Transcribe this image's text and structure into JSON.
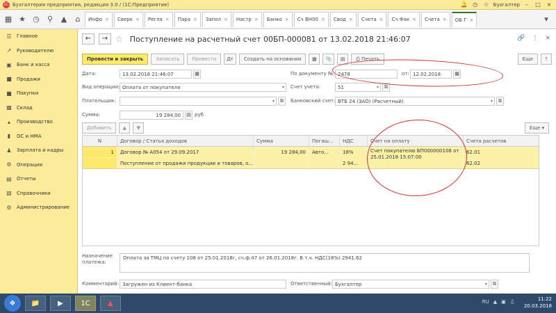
{
  "window": {
    "title": "Бухгалтерия предприятия, редакция 3.0 / (1С:Предприятие)",
    "user": "Бухгалтер"
  },
  "tabs": [
    {
      "label": "Инфо"
    },
    {
      "label": "Сверк"
    },
    {
      "label": "Регла"
    },
    {
      "label": "Пара"
    },
    {
      "label": "Запол"
    },
    {
      "label": "Настр"
    },
    {
      "label": "Банко"
    },
    {
      "label": "Сч ВН00"
    },
    {
      "label": "Свод"
    },
    {
      "label": "Счета"
    },
    {
      "label": "Сч Фак"
    },
    {
      "label": "Счета"
    },
    {
      "label": "ОБ Г"
    }
  ],
  "sidebar": {
    "items": [
      {
        "label": "Главное",
        "icon": "menu-icon"
      },
      {
        "label": "Руководителю",
        "icon": "chart-icon"
      },
      {
        "label": "Банк и касса",
        "icon": "bank-icon"
      },
      {
        "label": "Продажи",
        "icon": "cart-icon"
      },
      {
        "label": "Покупки",
        "icon": "basket-icon"
      },
      {
        "label": "Склад",
        "icon": "box-icon"
      },
      {
        "label": "Производство",
        "icon": "factory-icon"
      },
      {
        "label": "ОС и НМА",
        "icon": "building-icon"
      },
      {
        "label": "Зарплата и кадры",
        "icon": "people-icon"
      },
      {
        "label": "Операции",
        "icon": "operations-icon"
      },
      {
        "label": "Отчеты",
        "icon": "report-icon"
      },
      {
        "label": "Справочники",
        "icon": "book-icon"
      },
      {
        "label": "Администрирование",
        "icon": "gear-icon"
      }
    ]
  },
  "document": {
    "title": "Поступление на расчетный счет 00БП-000081 от 13.02.2018 21:46:07",
    "commands": {
      "post_close": "Провести и закрыть",
      "save": "Записать",
      "post": "Провести",
      "create_based": "Создать на основании",
      "print": "Печать",
      "more": "Еще",
      "help": "?"
    },
    "fields": {
      "date_label": "Дата:",
      "date_value": "13.02.2018 21:46:07",
      "op_label": "Вид операции:",
      "op_value": "Оплата от покупателя",
      "payer_label": "Плательщик:",
      "payer_value": "",
      "sum_label": "Сумма:",
      "sum_value": "19 284,00",
      "currency": "руб",
      "docnum_label": "По документу №:",
      "docnum_value": "2478",
      "docdate_label": "от:",
      "docdate_value": "12.02.2018",
      "account_label": "Счет учета:",
      "account_value": "51",
      "bank_label": "Банковский счет:",
      "bank_value": "ВТБ 24 (ЗАО) (Расчетный)"
    },
    "table": {
      "add_label": "Добавить",
      "more_label": "Еще",
      "headers": [
        "N",
        "Договор / Статья доходов",
        "Сумма",
        "Погаш...",
        "НДС",
        "Счет на оплату",
        "Счета расчетов"
      ],
      "row": {
        "n": "1",
        "contract": "Договор № А054 от 29.09.2017",
        "article": "Поступление от продажи продукции и товаров, о...",
        "sum": "19 284,00",
        "repay": "Авто...",
        "vat_rate": "18%",
        "vat_sum": "2 94...",
        "invoice": "Счет покупателю БП000000108 от 25.01.2018 15:07:00",
        "acc1": "62.01",
        "acc2": "62.02"
      }
    },
    "bottom": {
      "purpose_label": "Назначение платежа:",
      "purpose_value": "Оплата за ТМЦ по счету 108 от 25.01.2018г, сч.ф.47 от 26.01.2018г. В т.ч. НДС(18%) 2941.62",
      "comment_label": "Комментарий:",
      "comment_value": "Загружен из Клиент-банка",
      "responsible_label": "Ответственный:",
      "responsible_value": "Бухгалтер"
    }
  },
  "taskbar": {
    "lang": "RU",
    "time": "11:22",
    "date": "20.03.2018"
  }
}
